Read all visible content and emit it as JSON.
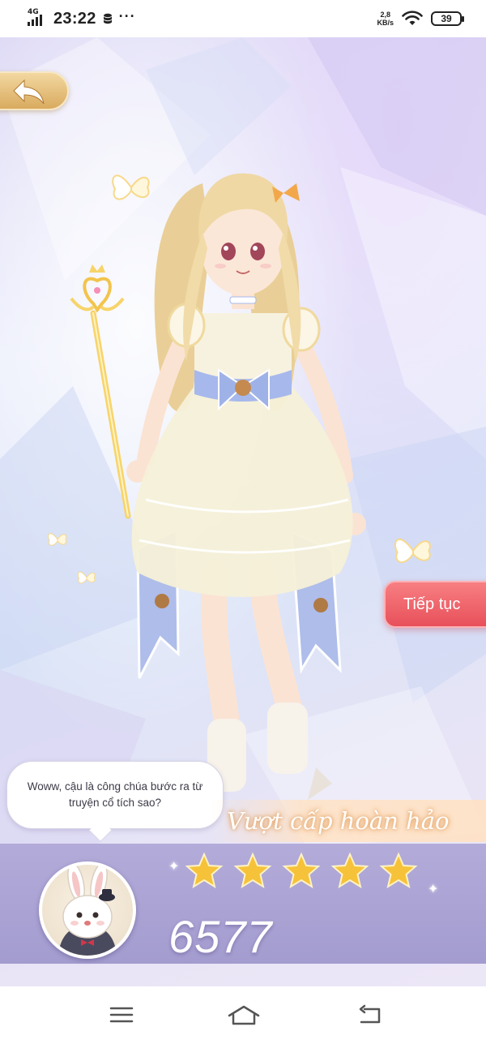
{
  "status_bar": {
    "network": "4G",
    "time": "23:22",
    "more": "···",
    "speed_value": "2,8",
    "speed_unit": "KB/s",
    "battery": "39"
  },
  "game": {
    "back_icon": "back-arrow-icon",
    "continue_label": "Tiếp tục",
    "dialogue": "Woww, cậu là công chúa bước ra từ truyện cổ tích sao?",
    "result_title": "Vượt cấp hoàn hảo",
    "stars_earned": 5,
    "stars_total": 5,
    "score": "6577",
    "colors": {
      "continue": "#e8505a",
      "panel": "#a39ccf",
      "star": "#f6c23a",
      "back_button": "#d9aa5f"
    }
  },
  "nav_bar": {
    "menu_icon": "menu-icon",
    "home_icon": "home-icon",
    "back_icon": "back-icon"
  }
}
